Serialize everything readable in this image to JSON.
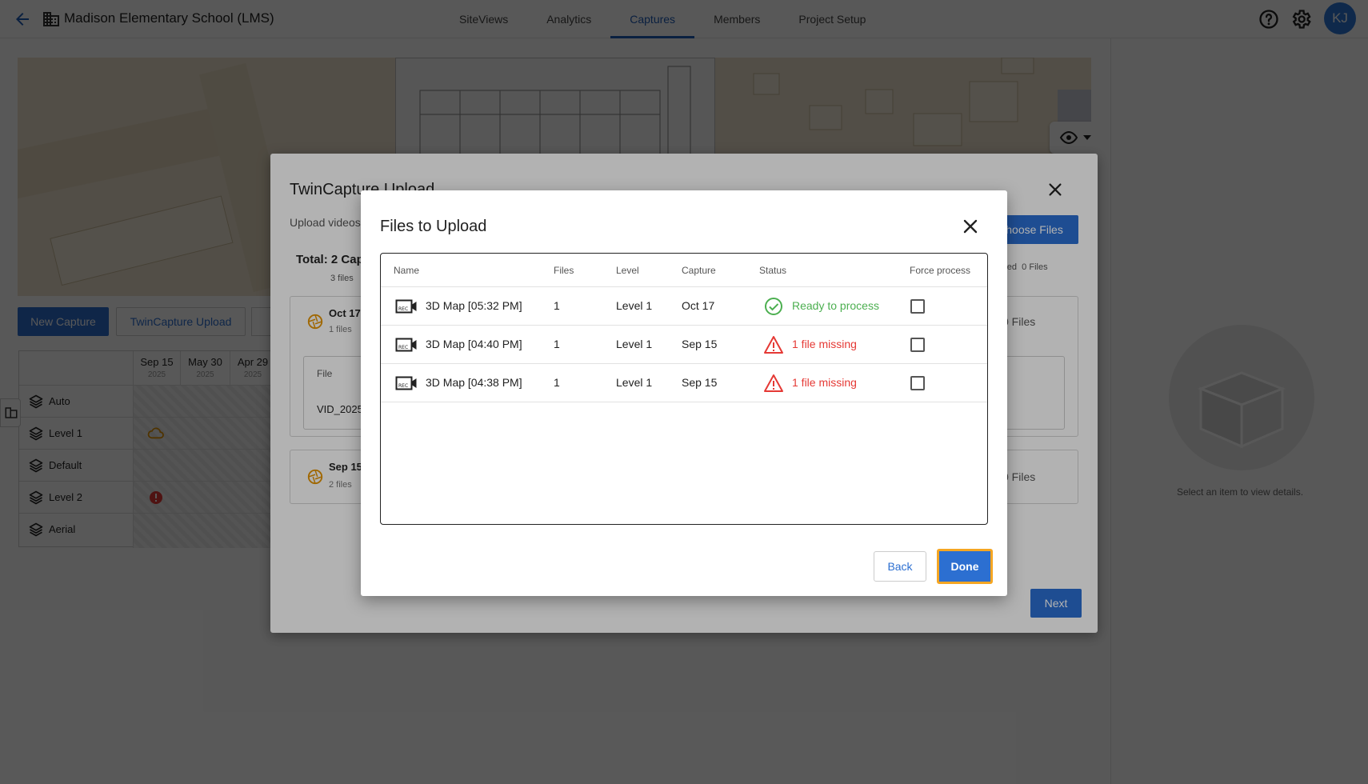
{
  "header": {
    "project_title": "Madison Elementary School (LMS)",
    "tabs": [
      {
        "label": "SiteViews"
      },
      {
        "label": "Analytics"
      },
      {
        "label": "Captures",
        "active": true
      },
      {
        "label": "Members"
      },
      {
        "label": "Project Setup"
      }
    ],
    "avatar_initials": "KJ"
  },
  "toolbar": {
    "new_capture_label": "New Capture",
    "twincapture_upload_label": "TwinCapture Upload"
  },
  "level_grid": {
    "columns": [
      {
        "date": "Sep 15",
        "year": "2025"
      },
      {
        "date": "May 30",
        "year": "2025"
      },
      {
        "date": "Apr 29",
        "year": "2025"
      }
    ],
    "rows": [
      {
        "label": "Auto"
      },
      {
        "label": "Level 1"
      },
      {
        "label": "Default"
      },
      {
        "label": "Level 2"
      },
      {
        "label": "Aerial"
      }
    ]
  },
  "details_panel": {
    "empty_text": "Select an item to view details."
  },
  "twincapture_dialog": {
    "title": "TwinCapture Upload",
    "subtitle": "Upload videos",
    "choose_files_label": "Choose Files",
    "total_label": "Total: 2 Cap",
    "total_files": "3 files",
    "uploaded_label": "loaded",
    "uploaded_files": "0 Files",
    "captures": [
      {
        "date": "Oct 17",
        "count": "1 files",
        "files_right": "0 Files",
        "file_header": "File",
        "file_name": "VID_2025"
      },
      {
        "date": "Sep 15",
        "count": "2 files",
        "files_right": "0 Files"
      }
    ],
    "next_label": "Next"
  },
  "files_dialog": {
    "title": "Files to Upload",
    "columns": {
      "name": "Name",
      "files": "Files",
      "level": "Level",
      "capture": "Capture",
      "status": "Status",
      "force": "Force process"
    },
    "rows": [
      {
        "name": "3D Map [05:32 PM]",
        "files": "1",
        "level": "Level 1",
        "capture": "Oct 17",
        "status": "Ready to process",
        "status_type": "ok",
        "force": false
      },
      {
        "name": "3D Map [04:40 PM]",
        "files": "1",
        "level": "Level 1",
        "capture": "Sep 15",
        "status": "1 file missing",
        "status_type": "missing",
        "force": false
      },
      {
        "name": "3D Map [04:38 PM]",
        "files": "1",
        "level": "Level 1",
        "capture": "Sep 15",
        "status": "1 file missing",
        "status_type": "missing",
        "force": false
      }
    ],
    "back_label": "Back",
    "done_label": "Done"
  },
  "colors": {
    "accent": "#2c6fd1",
    "ok": "#4caf50",
    "missing": "#e53935",
    "highlight": "#f5a623"
  }
}
